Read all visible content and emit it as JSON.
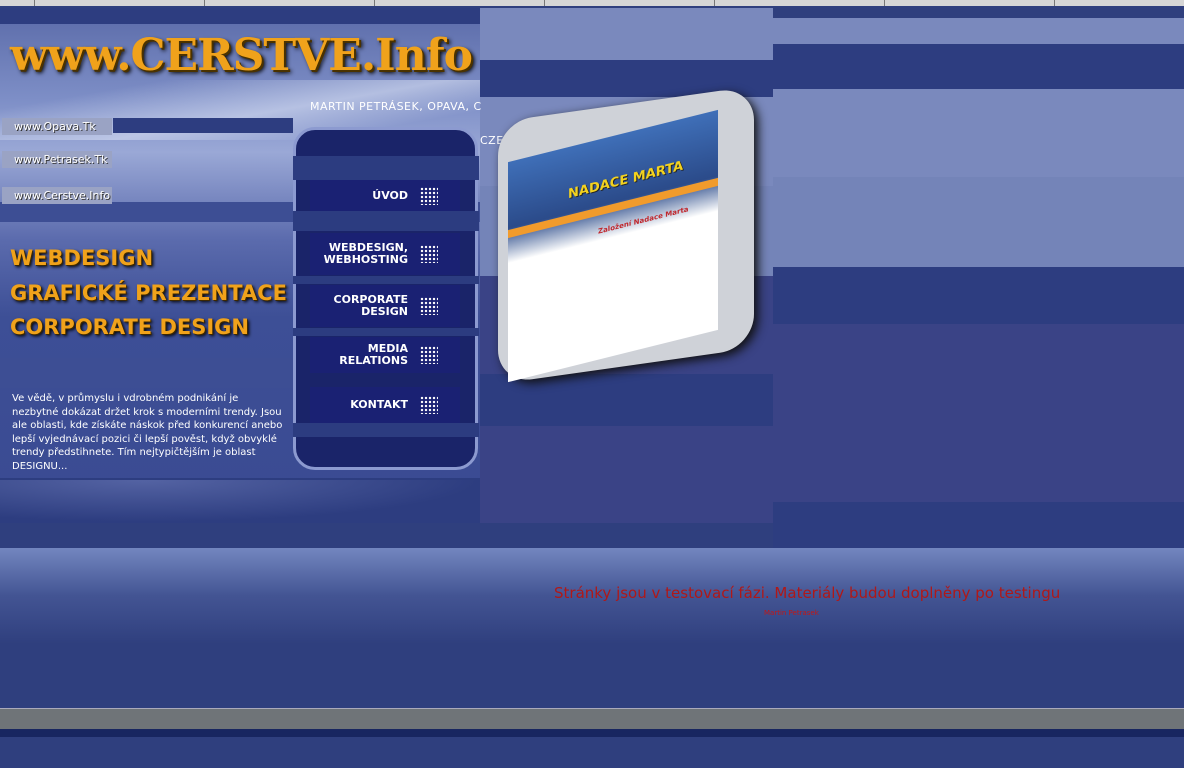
{
  "header": {
    "logo": "www.CERSTVE.Info",
    "tagline_part1": "MARTIN PETRÁSEK, OPAVA, C",
    "tagline_part2": "CZECH REPUBLIC"
  },
  "site_links": [
    "www.Opava.Tk",
    "www.Petrasek.Tk",
    "www.Cerstve.Info"
  ],
  "headings": [
    "WEBDESIGN",
    "GRAFICKÉ PREZENTACE",
    "CORPORATE DESIGN"
  ],
  "intro_text": "Ve vědě, v průmyslu i vdrobném podnikání je nezbytné dokázat držet krok s moderními trendy. Jsou ale oblasti, kde získáte náskok před konkurencí anebo lepší vyjednávací pozici či lepší pověst, když obvyklé trendy předstihnete. Tím nejtypičtějším je oblast DESIGNU...",
  "menu": {
    "items": [
      {
        "line1": "ÚVOD",
        "line2": ""
      },
      {
        "line1": "WEBDESIGN,",
        "line2": "WEBHOSTING"
      },
      {
        "line1": "CORPORATE",
        "line2": "DESIGN"
      },
      {
        "line1": "MEDIA",
        "line2": "RELATIONS"
      },
      {
        "line1": "KONTAKT",
        "line2": ""
      }
    ]
  },
  "thumbnail": {
    "banner": "NADACE MARTA",
    "caption": "Založení Nadace Marta"
  },
  "status": {
    "message": "Stránky jsou v testovací fázi. Materiály budou doplněny po testingu",
    "link": "Martin Petrasek"
  },
  "colors": {
    "accent_orange": "#f0a21b",
    "status_red": "#b01818",
    "navy": "#1a2173"
  }
}
